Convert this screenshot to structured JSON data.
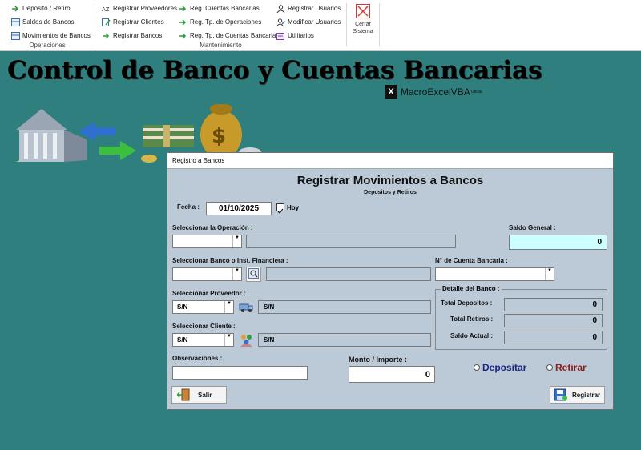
{
  "ribbon": {
    "operaciones": {
      "items": [
        "Deposito / Retiro",
        "Saldos de Bancos",
        "Movimientos de Bancos"
      ],
      "title": "Operaciones"
    },
    "mantenimiento": {
      "col1": [
        "Registrar Proveedores",
        "Registrar Clientes",
        "Registrar Bancos"
      ],
      "col2": [
        "Reg. Cuentas Bancarias",
        "Reg. Tp. de Operaciones",
        "Reg. Tp. de Cuentas Bancarias"
      ],
      "col3": [
        "Registrar Usuarios",
        "Modificar Usuarios",
        "Utilitarios"
      ],
      "title": "Mantenimiento"
    },
    "cerrar": {
      "line1": "Cerrar",
      "line2": "Sistema"
    }
  },
  "header": {
    "title": "Control de Banco y Cuentas Bancarias",
    "brand": "MacroExcelVBA",
    "brand_tm": "Oficial",
    "brand_logo": "X"
  },
  "form": {
    "window_title": "Registro a Bancos",
    "heading": "Registrar Movimientos a Bancos",
    "subheading": "Depositos y Retiros",
    "fecha_label": "Fecha :",
    "fecha_value": "01/10/2025",
    "hoy_label": "Hoy",
    "operacion_label": "Seleccionar la Operación :",
    "saldo_general_label": "Saldo General :",
    "saldo_general_value": "0",
    "banco_label": "Seleccionar Banco o Inst. Financiera :",
    "cuenta_label": "N° de Cuenta Bancaria :",
    "proveedor_label": "Seleccionar Proveedor :",
    "proveedor_value": "S/N",
    "proveedor_detail": "S/N",
    "cliente_label": "Seleccionar Cliente :",
    "cliente_value": "S/N",
    "cliente_detail": "S/N",
    "detalle_label": "Detalle del Banco :",
    "total_depositos_label": "Total Depositos :",
    "total_depositos_value": "0",
    "total_retiros_label": "Total Retiros :",
    "total_retiros_value": "0",
    "saldo_actual_label": "Saldo Actual :",
    "saldo_actual_value": "0",
    "observaciones_label": "Observaciones :",
    "monto_label": "Monto / Importe :",
    "monto_value": "0",
    "depositar_label": "Depositar",
    "retirar_label": "Retirar",
    "salir_label": "Salir",
    "registrar_label": "Registrar"
  },
  "colors": {
    "background": "#2f7f7f",
    "form_bg": "#bccad8",
    "saldo_general_bg": "#ccffff",
    "depositar": "#1a237e",
    "retirar": "#8b1a1a"
  }
}
